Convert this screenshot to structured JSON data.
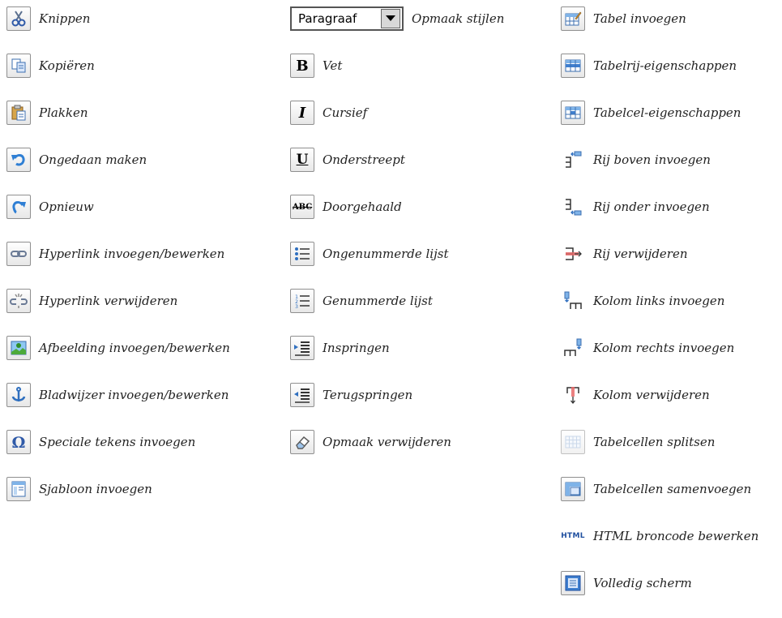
{
  "column1": [
    {
      "icon": "scissors-icon",
      "label": "Knippen"
    },
    {
      "icon": "copy-icon",
      "label": "Kopiëren"
    },
    {
      "icon": "paste-icon",
      "label": "Plakken"
    },
    {
      "icon": "undo-icon",
      "label": "Ongedaan maken"
    },
    {
      "icon": "redo-icon",
      "label": "Opnieuw"
    },
    {
      "icon": "link-icon",
      "label": "Hyperlink invoegen/bewerken"
    },
    {
      "icon": "unlink-icon",
      "label": "Hyperlink verwijderen"
    },
    {
      "icon": "image-icon",
      "label": "Afbeelding invoegen/bewerken"
    },
    {
      "icon": "anchor-icon",
      "label": "Bladwijzer invoegen/bewerken"
    },
    {
      "icon": "omega-icon",
      "label": "Speciale tekens invoegen"
    },
    {
      "icon": "template-icon",
      "label": "Sjabloon invoegen"
    }
  ],
  "column2": [
    {
      "icon": "format-dropdown",
      "label": "Opmaak stijlen",
      "dropdown_value": "Paragraaf"
    },
    {
      "icon": "bold-icon",
      "label": "Vet",
      "glyph": "B"
    },
    {
      "icon": "italic-icon",
      "label": "Cursief",
      "glyph": "I"
    },
    {
      "icon": "underline-icon",
      "label": "Onderstreept",
      "glyph": "U"
    },
    {
      "icon": "strikethrough-icon",
      "label": "Doorgehaald",
      "glyph": "ABC"
    },
    {
      "icon": "bulleted-list-icon",
      "label": "Ongenummerde lijst"
    },
    {
      "icon": "numbered-list-icon",
      "label": "Genummerde lijst"
    },
    {
      "icon": "indent-icon",
      "label": "Inspringen"
    },
    {
      "icon": "outdent-icon",
      "label": "Terugspringen"
    },
    {
      "icon": "eraser-icon",
      "label": "Opmaak verwijderen"
    }
  ],
  "column3": [
    {
      "icon": "table-insert-icon",
      "label": "Tabel invoegen"
    },
    {
      "icon": "table-row-properties-icon",
      "label": "Tabelrij-eigenschappen"
    },
    {
      "icon": "table-cell-properties-icon",
      "label": "Tabelcel-eigenschappen"
    },
    {
      "icon": "row-insert-above-icon",
      "label": "Rij boven invoegen"
    },
    {
      "icon": "row-insert-below-icon",
      "label": "Rij onder invoegen"
    },
    {
      "icon": "row-delete-icon",
      "label": "Rij verwijderen"
    },
    {
      "icon": "column-insert-left-icon",
      "label": "Kolom links invoegen"
    },
    {
      "icon": "column-insert-right-icon",
      "label": "Kolom rechts invoegen"
    },
    {
      "icon": "column-delete-icon",
      "label": "Kolom verwijderen"
    },
    {
      "icon": "cells-split-icon",
      "label": "Tabelcellen splitsen"
    },
    {
      "icon": "cells-merge-icon",
      "label": "Tabelcellen samenvoegen"
    },
    {
      "icon": "html-source-icon",
      "label": "HTML broncode bewerken",
      "glyph": "HTML"
    },
    {
      "icon": "fullscreen-icon",
      "label": "Volledig scherm"
    }
  ]
}
